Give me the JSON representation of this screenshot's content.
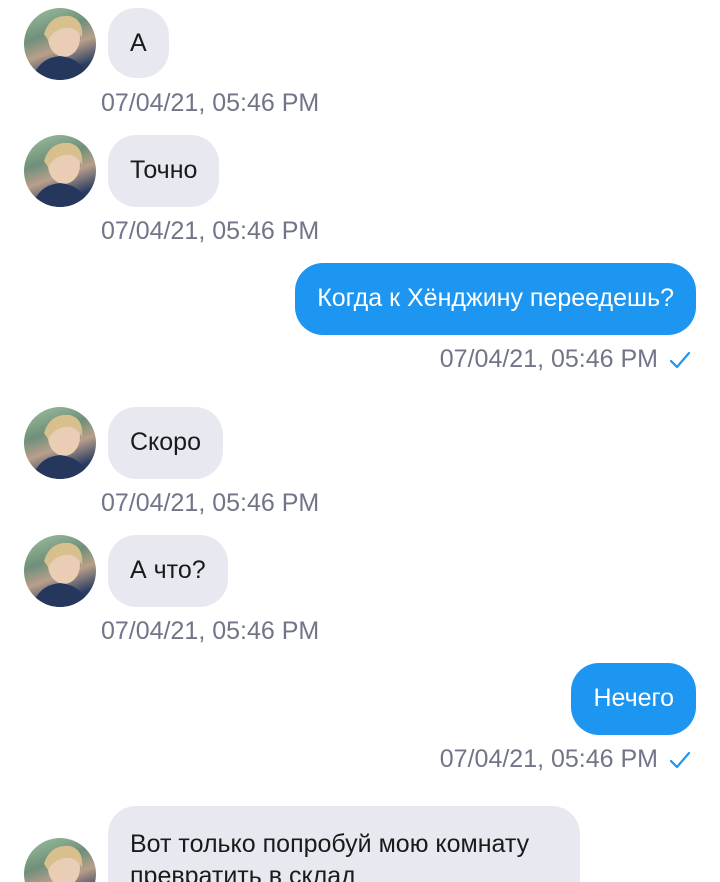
{
  "messages": [
    {
      "direction": "in",
      "text": "А",
      "time": "07/04/21, 05:46 PM"
    },
    {
      "direction": "in",
      "text": "Точно",
      "time": "07/04/21, 05:46 PM"
    },
    {
      "direction": "out",
      "text": "Когда к Хёнджину переедешь?",
      "time": "07/04/21, 05:46 PM",
      "status": "check-icon"
    },
    {
      "direction": "in",
      "text": "Скоро",
      "time": "07/04/21, 05:46 PM"
    },
    {
      "direction": "in",
      "text": "А что?",
      "time": "07/04/21, 05:46 PM"
    },
    {
      "direction": "out",
      "text": "Нечего",
      "time": "07/04/21, 05:46 PM",
      "status": "check-icon"
    },
    {
      "direction": "in",
      "text": "Вот только попробуй мою комнату превратить в склад"
    }
  ],
  "colors": {
    "incoming_bubble": "#e8e9f0",
    "outgoing_bubble": "#1d96f2",
    "timestamp": "#707687",
    "check": "#1d96f2"
  }
}
